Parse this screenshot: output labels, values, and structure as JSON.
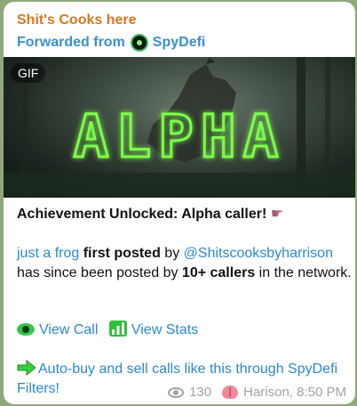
{
  "message": {
    "channel_name": "Shit's Cooks here",
    "forward_prefix": "Forwarded from",
    "forward_source": "SpyDefi",
    "media": {
      "badge": "GIF",
      "overlay_text": "ALPHA"
    },
    "headline": "Achievement Unlocked: Alpha caller!",
    "token_name": "just a frog",
    "first_posted": "first posted",
    "by": "by",
    "handle": "@Shitscooksbyharrison",
    "posted_text_1": "has since been posted by",
    "callers": "10+ callers",
    "posted_text_2": "in the network.",
    "view_call": "View Call",
    "view_stats": "View Stats",
    "promo": "Auto-buy and sell calls like this through SpyDefi Filters!",
    "views": "130",
    "author": "Harison, 8:50 PM"
  },
  "colors": {
    "channel": "#d67722",
    "link": "#2b87d3",
    "meta": "#9aa4ad",
    "background": "#8fa97a"
  },
  "icons": [
    "spydefi-avatar-icon",
    "pointing-hand-icon",
    "eye-emoji-icon",
    "chart-bars-emoji-icon",
    "right-arrow-emoji-icon",
    "views-eye-icon",
    "brain-icon"
  ]
}
